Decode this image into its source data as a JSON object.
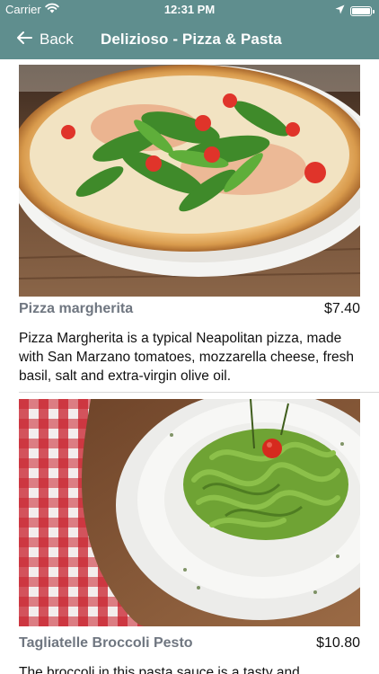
{
  "status_bar": {
    "carrier": "Carrier",
    "time": "12:31 PM"
  },
  "nav": {
    "back_label": "Back",
    "title": "Delizioso - Pizza & Pasta"
  },
  "colors": {
    "nav_background": "#5f8e8e",
    "dish_name": "#6f7680"
  },
  "menu": [
    {
      "name": "Pizza margherita",
      "price": "$7.40",
      "description": "Pizza Margherita is a typical Neapolitan pizza, made with San Marzano tomatoes, mozzarella cheese, fresh basil, salt and extra-virgin olive oil.",
      "image": "pizza-photo"
    },
    {
      "name": "Tagliatelle Broccoli Pesto",
      "price": "$10.80",
      "description": "The broccoli in this pasta sauce is a tasty and",
      "image": "pasta-photo"
    }
  ]
}
